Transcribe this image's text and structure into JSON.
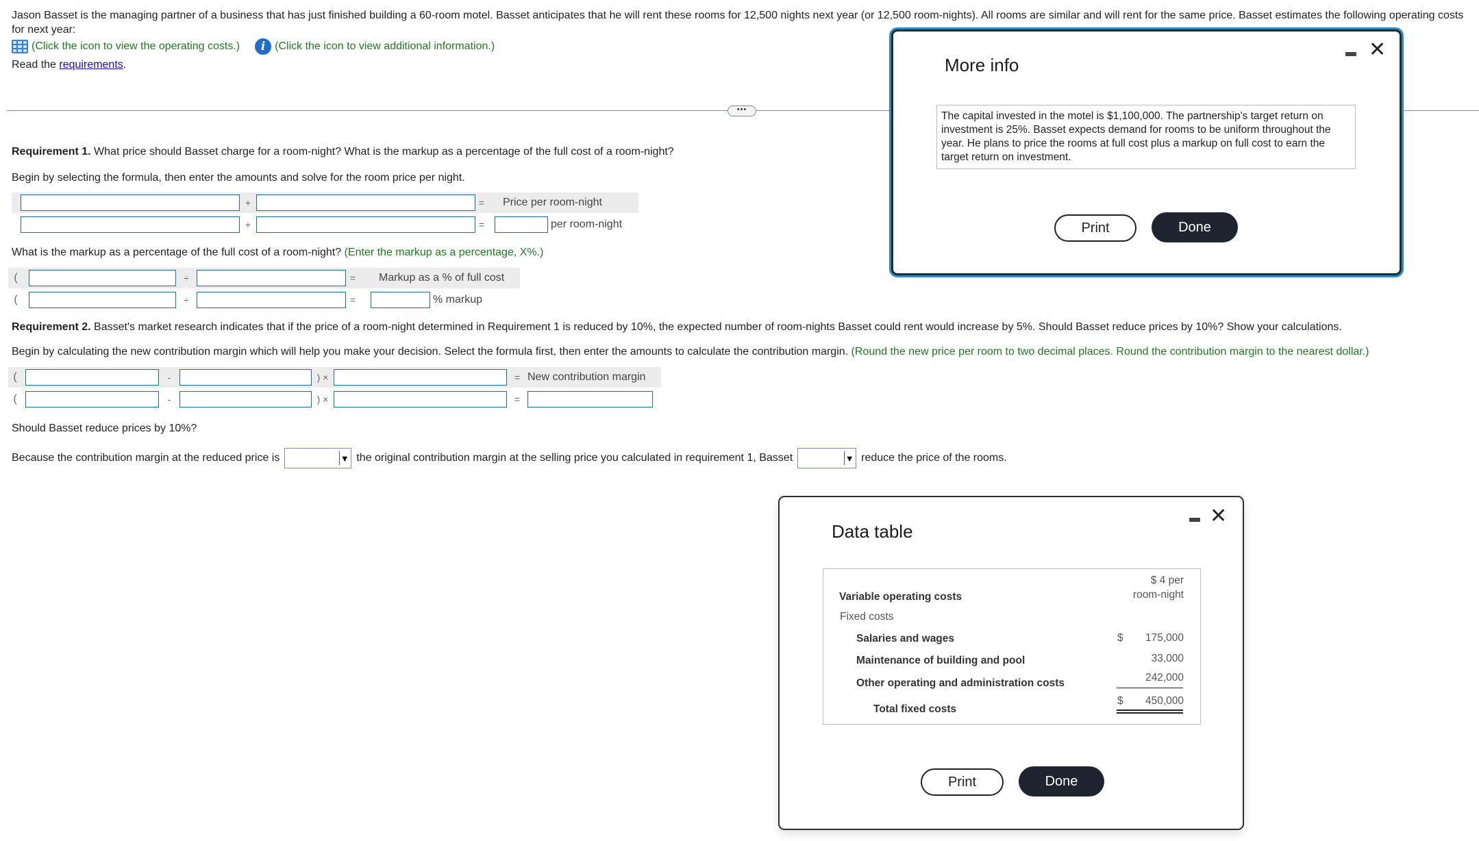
{
  "intro": {
    "line1": "Jason Basset is the managing partner of a business that has just finished building a 60-room motel. Basset anticipates that he will rent these rooms for 12,500 nights next year (or 12,500 room-nights). All rooms are similar and will rent for the same price. Basset estimates the following operating costs",
    "line2": "for next year:",
    "operating_costs_link": "(Click the icon to view the operating costs.)",
    "additional_info_link": "(Click the icon to view additional information.)",
    "read_the": "Read the ",
    "requirements_link": "requirements",
    "period": "."
  },
  "divider": {
    "expand_label": "•••"
  },
  "req1": {
    "heading_bold": "Requirement 1.",
    "heading_text": " What price should Basset charge for a room-night? What is the markup as a percentage of the full cost of a room-night?",
    "instruction": "Begin by selecting the formula, then enter the amounts and solve for the room price per night.",
    "formula1": {
      "op1": "+",
      "eq": "=",
      "result_label": "Price per room-night",
      "unit_label": "per room-night",
      "inputs": [
        "",
        "",
        "",
        ""
      ],
      "result_value": ""
    },
    "markup_question": "What is the markup as a percentage of the full cost of a room-night?",
    "markup_hint": "(Enter the markup as a percentage, X%.)",
    "formula2": {
      "paren": "(",
      "op1": "÷",
      "eq": "=",
      "result_label": "Markup as a % of full cost",
      "unit_label": "% markup",
      "inputs": [
        "",
        "",
        "",
        ""
      ],
      "result_value": ""
    }
  },
  "req2": {
    "heading_bold": "Requirement 2.",
    "heading_text": " Basset's market research indicates that if the price of a room-night determined in Requirement 1 is reduced by 10%, the expected number of room-nights Basset could rent would increase by 5%. Should Basset reduce prices by 10%? Show your calculations.",
    "instruction": "Begin by calculating the new contribution margin which will help you make your decision. Select the formula first, then enter the amounts to calculate the contribution margin.",
    "hint": "(Round the new price per room to two decimal places. Round the contribution margin to the nearest dollar.)",
    "formula": {
      "paren_open": "(",
      "minus": "-",
      "paren_times": ") ×",
      "eq": "=",
      "result_label": "New contribution margin",
      "inputs": [
        "",
        "",
        "",
        "",
        "",
        ""
      ],
      "result_value": ""
    },
    "question": "Should Basset reduce prices by 10%?",
    "sentence_part1": "Because the contribution margin at the reduced price is",
    "sentence_part2": "the original contribution margin at the selling price you calculated in requirement 1, Basset",
    "sentence_part3": "reduce the price of the rooms.",
    "dropdown1_value": "",
    "dropdown2_value": ""
  },
  "more_info_modal": {
    "title": "More info",
    "body": "The capital invested in the motel is $1,100,000. The partnership's target return on investment is 25%. Basset expects demand for rooms to be uniform throughout the year. He plans to price the rooms at full cost plus a markup on full cost to earn the target return on investment.",
    "print_label": "Print",
    "done_label": "Done",
    "minimize_icon": "minimize-icon",
    "close_icon": "close-icon",
    "accent_color": "#2e8bc2"
  },
  "data_table_modal": {
    "title": "Data table",
    "rows": {
      "variable_label": "Variable operating costs",
      "variable_value_line1": "$ 4 per",
      "variable_value_line2": "room-night",
      "fixed_label": "Fixed costs",
      "salaries_label": "Salaries and wages",
      "salaries_currency": "$",
      "salaries_value": "175,000",
      "maintenance_label": "Maintenance of building and pool",
      "maintenance_value": "33,000",
      "other_label": "Other operating and administration costs",
      "other_value": "242,000",
      "total_label": "Total fixed costs",
      "total_currency": "$",
      "total_value": "450,000"
    },
    "print_label": "Print",
    "done_label": "Done"
  },
  "colors": {
    "hint_green": "#1f7a1f",
    "link_blue": "#1a0dab",
    "input_border": "#1e6f8a",
    "done_button_bg": "#1e2430"
  }
}
